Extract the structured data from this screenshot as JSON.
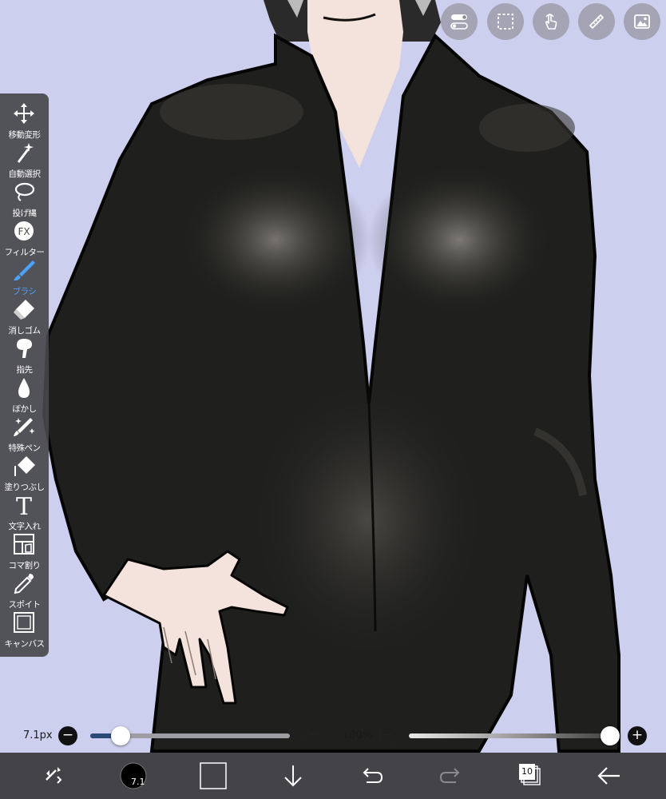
{
  "toolbar": {
    "tools": [
      {
        "label": "移動変形",
        "icon": "move-icon"
      },
      {
        "label": "自動選択",
        "icon": "magic-wand-icon"
      },
      {
        "label": "投げ縄",
        "icon": "lasso-icon"
      },
      {
        "label": "フィルター",
        "icon": "fx-icon",
        "icon_text": "FX"
      },
      {
        "label": "ブラシ",
        "icon": "brush-icon",
        "active": true
      },
      {
        "label": "消しゴム",
        "icon": "eraser-icon"
      },
      {
        "label": "指先",
        "icon": "smudge-icon"
      },
      {
        "label": "ぼかし",
        "icon": "blur-drop-icon"
      },
      {
        "label": "特殊ペン",
        "icon": "special-pen-icon"
      },
      {
        "label": "塗りつぶし",
        "icon": "bucket-icon"
      },
      {
        "label": "文字入れ",
        "icon": "text-icon",
        "icon_text": "T"
      },
      {
        "label": "コマ割り",
        "icon": "frame-divider-icon"
      },
      {
        "label": "スポイト",
        "icon": "eyedropper-icon"
      },
      {
        "label": "キャンバス",
        "icon": "canvas-icon"
      }
    ],
    "active_color": "#4aa3ff"
  },
  "top_buttons": [
    "toggle-icon",
    "selection-icon",
    "hand-touch-icon",
    "ruler-icon",
    "gallery-icon"
  ],
  "brush_size": {
    "value_label": "7.1px",
    "minus": "−",
    "plus": "+",
    "level": 0.15
  },
  "opacity": {
    "value_label": "100%",
    "minus": "−",
    "plus": "+",
    "level": 1.0
  },
  "bottom_bar": {
    "color_badge": "7.1",
    "layer_count": "10",
    "icons": [
      "transform-arrows-icon",
      "brush-color-icon",
      "secondary-color-icon",
      "download-icon",
      "undo-icon",
      "redo-icon",
      "layers-icon",
      "back-arrow-icon"
    ]
  },
  "colors": {
    "background": "#cdcfee",
    "suit": "#1e1e1c",
    "skin": "#f4e2dc",
    "slider_fill": "#2c4a78"
  }
}
